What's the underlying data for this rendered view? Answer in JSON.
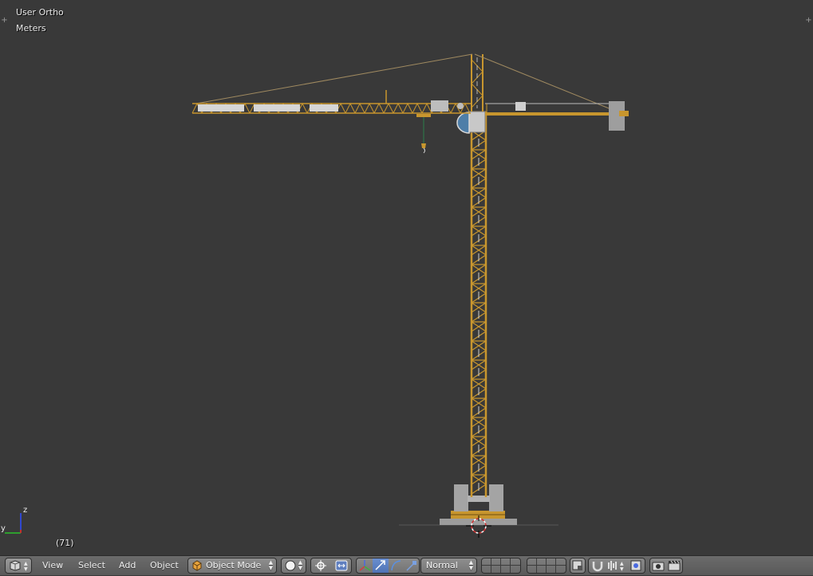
{
  "viewport": {
    "view_label": "User Ortho",
    "units_label": "Meters",
    "frame_label": "(71)",
    "axis_labels": {
      "y": "y",
      "z": "z"
    },
    "colors": {
      "background": "#393939",
      "crane_yellow": "#c8962e",
      "axis_x": "#c03030",
      "axis_y": "#2e9e2e",
      "axis_z": "#3048d0"
    }
  },
  "header": {
    "editor_type_icon": "3d-view-icon",
    "menus": [
      "View",
      "Select",
      "Add",
      "Object"
    ],
    "mode": {
      "label": "Object Mode",
      "icon": "object-cube-icon"
    },
    "shading_icon": "solid-sphere-icon",
    "pivot_icons": [
      "pivot-point-icon",
      "manipulator-transform-icon"
    ],
    "manipulator_icons": [
      "translate-axis-icon",
      "translate-arrow-icon",
      "rotate-arc-icon",
      "scale-icon"
    ],
    "orientation": {
      "label": "Normal"
    },
    "layer_icons": [
      "layer-grid-1-icon",
      "layer-grid-2-icon"
    ],
    "tool_icons": [
      "lock-layers-icon",
      "snap-magnet-icon",
      "snap-element-icon",
      "snap-target-icon",
      "render-camera-icon",
      "render-clapper-icon"
    ]
  }
}
